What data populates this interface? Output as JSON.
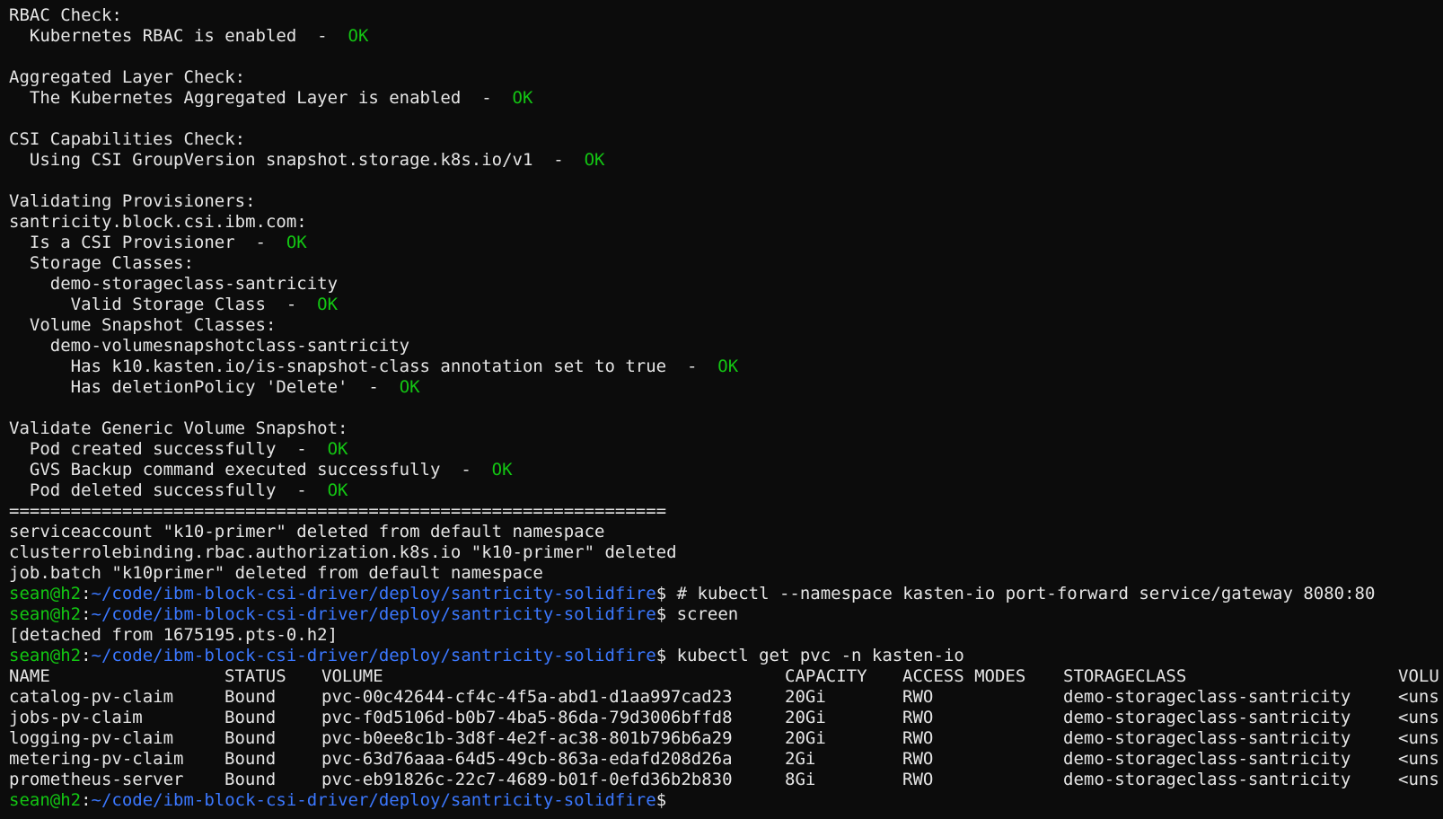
{
  "checks": {
    "rbac_header": "RBAC Check:",
    "rbac_item": "  Kubernetes RBAC is enabled  -  ",
    "agg_header": "Aggregated Layer Check:",
    "agg_item": "  The Kubernetes Aggregated Layer is enabled  -  ",
    "csi_header": "CSI Capabilities Check:",
    "csi_item": "  Using CSI GroupVersion snapshot.storage.k8s.io/v1  -  ",
    "prov_header": "Validating Provisioners:",
    "prov_name": "santricity.block.csi.ibm.com:",
    "prov_is_csi": "  Is a CSI Provisioner  -  ",
    "storage_classes": "  Storage Classes:",
    "storage_class_name": "    demo-storageclass-santricity",
    "valid_storage_class": "      Valid Storage Class  -  ",
    "vsc_header": "  Volume Snapshot Classes:",
    "vsc_name": "    demo-volumesnapshotclass-santricity",
    "vsc_annotation": "      Has k10.kasten.io/is-snapshot-class annotation set to true  -  ",
    "vsc_deletion": "      Has deletionPolicy 'Delete'  -  ",
    "gvs_header": "Validate Generic Volume Snapshot:",
    "gvs_pod_created": "  Pod created successfully  -  ",
    "gvs_backup": "  GVS Backup command executed successfully  -  ",
    "gvs_pod_deleted": "  Pod deleted successfully  -  ",
    "ok_label": "OK"
  },
  "separator": "================================================================",
  "cleanup": {
    "sa": "serviceaccount \"k10-primer\" deleted from default namespace",
    "crb": "clusterrolebinding.rbac.authorization.k8s.io \"k10-primer\" deleted",
    "job": "job.batch \"k10primer\" deleted from default namespace"
  },
  "prompt": {
    "user_host": "sean@h2",
    "colon": ":",
    "path": "~/code/ibm-block-csi-driver/deploy/santricity-solidfire",
    "symbol": "$ "
  },
  "commands": {
    "cmd1": "# kubectl --namespace kasten-io port-forward service/gateway 8080:80",
    "cmd2": "screen",
    "detached": "[detached from 1675195.pts-0.h2]",
    "cmd3": "kubectl get pvc -n kasten-io"
  },
  "pvc_table": {
    "headers": [
      "NAME",
      "STATUS",
      "VOLUME",
      "CAPACITY",
      "ACCESS MODES",
      "STORAGECLASS",
      "VOLU"
    ],
    "rows": [
      [
        "catalog-pv-claim",
        "Bound",
        "pvc-00c42644-cf4c-4f5a-abd1-d1aa997cad23",
        "20Gi",
        "RWO",
        "demo-storageclass-santricity",
        "<uns"
      ],
      [
        "jobs-pv-claim",
        "Bound",
        "pvc-f0d5106d-b0b7-4ba5-86da-79d3006bffd8",
        "20Gi",
        "RWO",
        "demo-storageclass-santricity",
        "<uns"
      ],
      [
        "logging-pv-claim",
        "Bound",
        "pvc-b0ee8c1b-3d8f-4e2f-ac38-801b796b6a29",
        "20Gi",
        "RWO",
        "demo-storageclass-santricity",
        "<uns"
      ],
      [
        "metering-pv-claim",
        "Bound",
        "pvc-63d76aaa-64d5-49cb-863a-edafd208d26a",
        "2Gi",
        "RWO",
        "demo-storageclass-santricity",
        "<uns"
      ],
      [
        "prometheus-server",
        "Bound",
        "pvc-eb91826c-22c7-4689-b01f-0efd36b2b830",
        "8Gi",
        "RWO",
        "demo-storageclass-santricity",
        "<uns"
      ]
    ]
  },
  "colors": {
    "background": "#0c0c0c",
    "text": "#e6e6e6",
    "ok": "#13c613",
    "prompt_user": "#13c613",
    "prompt_path": "#3b78ff"
  }
}
